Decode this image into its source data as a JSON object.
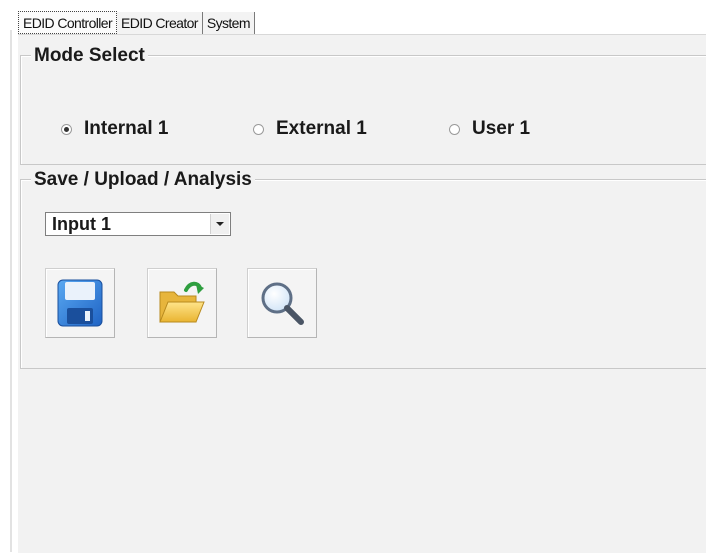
{
  "tabs": [
    {
      "label": "EDID Controller",
      "active": true
    },
    {
      "label": "EDID Creator",
      "active": false
    },
    {
      "label": "System",
      "active": false
    }
  ],
  "mode_select": {
    "title": "Mode Select",
    "options": [
      {
        "label": "Internal 1",
        "checked": true
      },
      {
        "label": "External 1",
        "checked": false
      },
      {
        "label": "User 1",
        "checked": false
      }
    ]
  },
  "save_upload": {
    "title": "Save / Upload / Analysis",
    "input_select": {
      "value": "Input 1"
    },
    "buttons": [
      {
        "icon": "save-icon"
      },
      {
        "icon": "open-folder-icon"
      },
      {
        "icon": "magnifier-icon"
      }
    ]
  },
  "colors": {
    "panel_bg": "#f2f2f2",
    "floppy_blue": "#2f7fd8",
    "folder_yellow": "#f2c94c",
    "arrow_green": "#2e9e3f"
  }
}
